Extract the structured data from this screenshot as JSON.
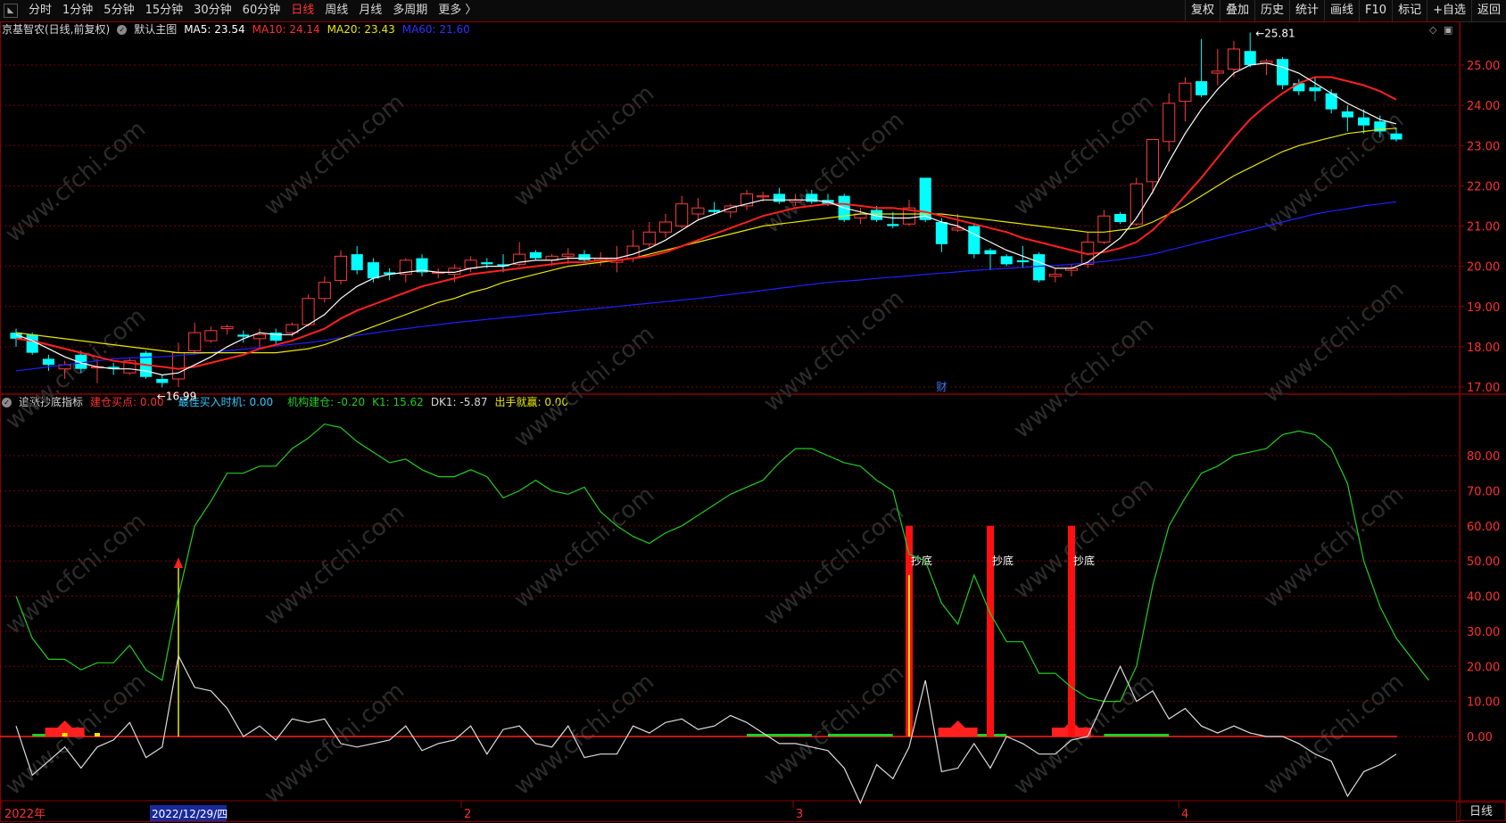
{
  "toolbar": {
    "periods": [
      "分时",
      "1分钟",
      "5分钟",
      "15分钟",
      "30分钟",
      "60分钟",
      "日线",
      "周线",
      "月线",
      "多周期",
      "更多 〉"
    ],
    "active_period": "日线",
    "tools": [
      "复权",
      "叠加",
      "历史",
      "统计",
      "画线",
      "F10",
      "标记",
      "+自选",
      "返回"
    ]
  },
  "main_header": {
    "stock": "京基智农(日线,前复权)",
    "template": "默认主图",
    "ma5": "MA5: 23.54",
    "ma10": "MA10: 24.14",
    "ma20": "MA20: 23.43",
    "ma60": "MA60: 21.60"
  },
  "sub_header": {
    "indicator": "追涨抄底指标",
    "build_buy": "建仓买点: 0.00",
    "best_buy": "最佳买入时机: 0.00",
    "inst_build": "机构建仓: -0.20",
    "k1": "K1: 15.62",
    "dk1": "DK1: -5.87",
    "win": "出手就赢: 0.00"
  },
  "watermark": "www.cfchi.com",
  "bottom": {
    "period_label": "日线",
    "date_labels": [
      "2022年",
      "2",
      "3",
      "4"
    ],
    "cursor_date": "2022/12/29/四"
  },
  "annotations": {
    "high": "25.81",
    "low": "16.99",
    "fin_marker": "财",
    "signal_label": "抄底"
  },
  "colors": {
    "up": "#ff3b3b",
    "down": "#00ffff",
    "ma5": "#ffffff",
    "ma10": "#ff2020",
    "ma20": "#e8e800",
    "ma60": "#2020ff",
    "green": "#22cc22",
    "grid": "#7a0000"
  },
  "chart_data": [
    {
      "type": "candlestick",
      "title": "京基智农(日线,前复权)",
      "ylim": [
        16.6,
        26.0
      ],
      "yticks": [
        "17.00",
        "18.00",
        "19.00",
        "20.00",
        "21.00",
        "22.00",
        "23.00",
        "24.00",
        "25.00"
      ],
      "candles": [
        [
          18.35,
          18.45,
          18.0,
          18.2
        ],
        [
          18.3,
          18.35,
          17.8,
          17.85
        ],
        [
          17.7,
          17.8,
          17.4,
          17.55
        ],
        [
          17.45,
          17.65,
          17.2,
          17.55
        ],
        [
          17.8,
          17.9,
          17.35,
          17.45
        ],
        [
          17.5,
          17.7,
          17.1,
          17.5
        ],
        [
          17.5,
          17.6,
          17.3,
          17.45
        ],
        [
          17.35,
          17.7,
          17.3,
          17.65
        ],
        [
          17.85,
          17.9,
          17.2,
          17.25
        ],
        [
          17.2,
          17.3,
          16.99,
          17.1
        ],
        [
          17.2,
          18.1,
          17.0,
          17.85
        ],
        [
          17.9,
          18.6,
          17.8,
          18.35
        ],
        [
          18.15,
          18.5,
          18.1,
          18.4
        ],
        [
          18.45,
          18.55,
          18.3,
          18.5
        ],
        [
          18.3,
          18.4,
          18.1,
          18.25
        ],
        [
          18.2,
          18.45,
          18.0,
          18.3
        ],
        [
          18.35,
          18.45,
          18.05,
          18.15
        ],
        [
          18.35,
          18.6,
          18.25,
          18.55
        ],
        [
          18.55,
          19.3,
          18.5,
          19.2
        ],
        [
          19.2,
          19.75,
          19.1,
          19.6
        ],
        [
          19.65,
          20.4,
          19.55,
          20.25
        ],
        [
          20.3,
          20.5,
          19.8,
          19.9
        ],
        [
          20.1,
          20.2,
          19.6,
          19.7
        ],
        [
          19.85,
          19.95,
          19.65,
          19.8
        ],
        [
          19.8,
          20.2,
          19.6,
          20.15
        ],
        [
          20.2,
          20.3,
          19.75,
          19.85
        ],
        [
          19.85,
          19.95,
          19.7,
          19.85
        ],
        [
          19.8,
          20.05,
          19.6,
          19.95
        ],
        [
          19.95,
          20.25,
          19.85,
          20.15
        ],
        [
          20.1,
          20.2,
          19.95,
          20.05
        ],
        [
          20.05,
          20.3,
          19.85,
          20.0
        ],
        [
          20.05,
          20.6,
          20.0,
          20.3
        ],
        [
          20.35,
          20.4,
          20.15,
          20.2
        ],
        [
          20.15,
          20.3,
          20.0,
          20.25
        ],
        [
          20.25,
          20.45,
          20.05,
          20.3
        ],
        [
          20.3,
          20.4,
          20.1,
          20.15
        ],
        [
          20.15,
          20.35,
          20.0,
          20.2
        ],
        [
          20.1,
          20.5,
          19.85,
          20.15
        ],
        [
          20.2,
          20.9,
          20.1,
          20.5
        ],
        [
          20.55,
          21.1,
          20.45,
          20.85
        ],
        [
          20.85,
          21.3,
          20.7,
          21.1
        ],
        [
          21.0,
          21.75,
          20.95,
          21.55
        ],
        [
          21.3,
          21.7,
          21.15,
          21.45
        ],
        [
          21.4,
          21.6,
          21.3,
          21.35
        ],
        [
          21.35,
          21.55,
          21.2,
          21.5
        ],
        [
          21.5,
          21.9,
          21.4,
          21.8
        ],
        [
          21.75,
          21.85,
          21.6,
          21.75
        ],
        [
          21.8,
          21.95,
          21.55,
          21.6
        ],
        [
          21.6,
          21.8,
          21.5,
          21.65
        ],
        [
          21.8,
          21.9,
          21.55,
          21.6
        ],
        [
          21.65,
          21.8,
          21.5,
          21.55
        ],
        [
          21.75,
          21.8,
          21.1,
          21.15
        ],
        [
          21.2,
          21.45,
          21.05,
          21.3
        ],
        [
          21.4,
          21.5,
          21.1,
          21.15
        ],
        [
          21.05,
          21.35,
          20.95,
          21.0
        ],
        [
          21.05,
          21.65,
          21.0,
          21.45
        ],
        [
          22.2,
          22.2,
          21.1,
          21.15
        ],
        [
          21.1,
          21.2,
          20.35,
          20.55
        ],
        [
          20.9,
          21.3,
          20.85,
          20.95
        ],
        [
          21.0,
          21.05,
          20.2,
          20.3
        ],
        [
          20.4,
          20.45,
          19.9,
          20.3
        ],
        [
          20.25,
          20.3,
          20.0,
          20.05
        ],
        [
          20.15,
          20.5,
          19.95,
          20.1
        ],
        [
          20.3,
          20.35,
          19.6,
          19.65
        ],
        [
          19.75,
          19.95,
          19.6,
          19.8
        ],
        [
          19.9,
          20.05,
          19.75,
          19.95
        ],
        [
          20.05,
          20.85,
          19.95,
          20.6
        ],
        [
          20.6,
          21.4,
          20.55,
          21.25
        ],
        [
          21.3,
          21.35,
          21.05,
          21.1
        ],
        [
          21.05,
          22.2,
          21.0,
          22.05
        ],
        [
          22.1,
          22.7,
          21.8,
          23.15
        ],
        [
          23.1,
          24.3,
          22.85,
          24.05
        ],
        [
          24.1,
          24.7,
          23.6,
          24.55
        ],
        [
          24.6,
          25.65,
          24.2,
          24.25
        ],
        [
          24.8,
          25.4,
          24.5,
          24.85
        ],
        [
          24.9,
          25.6,
          24.7,
          25.4
        ],
        [
          25.35,
          25.81,
          24.95,
          25.0
        ],
        [
          25.05,
          25.15,
          24.75,
          25.1
        ],
        [
          25.15,
          25.2,
          24.4,
          24.5
        ],
        [
          24.55,
          24.65,
          24.25,
          24.35
        ],
        [
          24.45,
          24.7,
          24.1,
          24.35
        ],
        [
          24.3,
          24.4,
          23.8,
          23.9
        ],
        [
          23.85,
          24.0,
          23.35,
          23.7
        ],
        [
          23.7,
          23.9,
          23.3,
          23.5
        ],
        [
          23.6,
          23.75,
          23.2,
          23.35
        ],
        [
          23.3,
          23.45,
          23.1,
          23.15
        ]
      ],
      "ma5": [
        18.3,
        18.15,
        17.95,
        17.75,
        17.6,
        17.5,
        17.45,
        17.45,
        17.4,
        17.3,
        17.35,
        17.55,
        17.75,
        18.0,
        18.2,
        18.35,
        18.3,
        18.3,
        18.55,
        18.8,
        19.2,
        19.5,
        19.7,
        19.8,
        19.85,
        19.9,
        19.85,
        19.85,
        19.95,
        20.0,
        20.0,
        20.1,
        20.15,
        20.15,
        20.2,
        20.2,
        20.2,
        20.2,
        20.3,
        20.45,
        20.65,
        20.9,
        21.15,
        21.3,
        21.45,
        21.55,
        21.65,
        21.65,
        21.65,
        21.65,
        21.6,
        21.45,
        21.35,
        21.25,
        21.2,
        21.2,
        21.25,
        21.1,
        21.0,
        20.8,
        20.6,
        20.4,
        20.25,
        20.1,
        19.95,
        19.95,
        20.1,
        20.4,
        20.7,
        21.2,
        21.85,
        22.6,
        23.3,
        23.9,
        24.4,
        24.8,
        25.0,
        25.05,
        24.95,
        24.8,
        24.55,
        24.3,
        24.05,
        23.85,
        23.65,
        23.54
      ],
      "ma10": [
        18.2,
        18.15,
        18.05,
        17.95,
        17.85,
        17.75,
        17.65,
        17.6,
        17.55,
        17.5,
        17.45,
        17.5,
        17.6,
        17.7,
        17.8,
        17.95,
        18.05,
        18.15,
        18.3,
        18.45,
        18.7,
        18.9,
        19.05,
        19.2,
        19.35,
        19.5,
        19.6,
        19.7,
        19.8,
        19.85,
        19.9,
        19.95,
        20.0,
        20.05,
        20.1,
        20.1,
        20.15,
        20.15,
        20.2,
        20.25,
        20.35,
        20.5,
        20.65,
        20.8,
        20.95,
        21.1,
        21.25,
        21.35,
        21.45,
        21.5,
        21.55,
        21.55,
        21.5,
        21.45,
        21.45,
        21.4,
        21.35,
        21.25,
        21.15,
        21.05,
        20.95,
        20.85,
        20.7,
        20.6,
        20.5,
        20.4,
        20.3,
        20.35,
        20.45,
        20.6,
        20.9,
        21.3,
        21.75,
        22.2,
        22.7,
        23.2,
        23.65,
        24.0,
        24.3,
        24.55,
        24.7,
        24.7,
        24.6,
        24.5,
        24.35,
        24.14
      ],
      "ma20": [
        18.35,
        18.3,
        18.25,
        18.2,
        18.15,
        18.1,
        18.05,
        18.0,
        17.95,
        17.9,
        17.85,
        17.85,
        17.85,
        17.85,
        17.85,
        17.85,
        17.85,
        17.9,
        17.95,
        18.05,
        18.2,
        18.35,
        18.5,
        18.65,
        18.8,
        18.95,
        19.1,
        19.2,
        19.35,
        19.45,
        19.6,
        19.7,
        19.8,
        19.9,
        20.0,
        20.05,
        20.1,
        20.15,
        20.2,
        20.3,
        20.4,
        20.5,
        20.6,
        20.7,
        20.8,
        20.9,
        21.0,
        21.05,
        21.1,
        21.15,
        21.2,
        21.25,
        21.3,
        21.3,
        21.3,
        21.3,
        21.3,
        21.3,
        21.25,
        21.2,
        21.15,
        21.1,
        21.05,
        21.0,
        20.95,
        20.9,
        20.85,
        20.85,
        20.9,
        20.95,
        21.1,
        21.3,
        21.5,
        21.75,
        22.0,
        22.25,
        22.45,
        22.65,
        22.85,
        23.0,
        23.1,
        23.2,
        23.3,
        23.35,
        23.4,
        23.43
      ],
      "ma60": [
        17.4,
        17.45,
        17.5,
        17.55,
        17.6,
        17.65,
        17.7,
        17.72,
        17.74,
        17.75,
        17.78,
        17.82,
        17.86,
        17.9,
        17.94,
        17.98,
        18.02,
        18.06,
        18.1,
        18.16,
        18.22,
        18.28,
        18.34,
        18.4,
        18.45,
        18.5,
        18.55,
        18.6,
        18.64,
        18.68,
        18.72,
        18.76,
        18.8,
        18.84,
        18.88,
        18.92,
        18.96,
        19.0,
        19.04,
        19.08,
        19.12,
        19.16,
        19.2,
        19.25,
        19.3,
        19.35,
        19.4,
        19.45,
        19.5,
        19.55,
        19.6,
        19.63,
        19.66,
        19.7,
        19.73,
        19.76,
        19.8,
        19.83,
        19.86,
        19.9,
        19.92,
        19.95,
        19.97,
        20.0,
        20.02,
        20.05,
        20.08,
        20.12,
        20.17,
        20.23,
        20.3,
        20.4,
        20.5,
        20.6,
        20.7,
        20.8,
        20.9,
        21.0,
        21.1,
        21.2,
        21.3,
        21.37,
        21.43,
        21.5,
        21.55,
        21.6
      ]
    },
    {
      "type": "line",
      "title": "追涨抄底指标",
      "ylim": [
        -20,
        92
      ],
      "yticks": [
        "0.00",
        "10.00",
        "20.00",
        "30.00",
        "40.00",
        "50.00",
        "60.00",
        "70.00",
        "80.00"
      ],
      "series": [
        {
          "name": "K1",
          "values": [
            40,
            28,
            22,
            22,
            19,
            21,
            21,
            26,
            19,
            16,
            40,
            60,
            67,
            75,
            75,
            77,
            77,
            82,
            85,
            89,
            88,
            84,
            81,
            78,
            79,
            76,
            74,
            74,
            76,
            74,
            68,
            70,
            73,
            70,
            69,
            71,
            64,
            60,
            57,
            55,
            58,
            60,
            63,
            66,
            69,
            71,
            73,
            78,
            82,
            82,
            80,
            78,
            77,
            73,
            70,
            52,
            50,
            38,
            32,
            46,
            35,
            27,
            27,
            18,
            18,
            14,
            11,
            10,
            10,
            20,
            43,
            60,
            68,
            75,
            77,
            80,
            81,
            82,
            86,
            87,
            86,
            82,
            72,
            50,
            37,
            28,
            22,
            16
          ]
        },
        {
          "name": "white",
          "values": [
            3,
            -11,
            -7,
            -3,
            -9,
            -3,
            -1,
            4,
            -6,
            -3,
            23,
            14,
            13,
            8,
            0,
            3,
            -1,
            5,
            4,
            5,
            -2,
            -3,
            -2,
            -1,
            3,
            -4,
            -2,
            -1,
            3,
            -5,
            2,
            3,
            -2,
            -3,
            3,
            -6,
            -5,
            -5,
            3,
            1,
            4,
            5,
            2,
            3,
            6,
            4,
            1,
            -2,
            -2,
            -3,
            -4,
            -9,
            -19,
            -8,
            -12,
            -3,
            16,
            -10,
            -9,
            -2,
            -9,
            0,
            -2,
            -5,
            -5,
            -1,
            0,
            10,
            20,
            10,
            13,
            5,
            8,
            3,
            1,
            3,
            1,
            0,
            0,
            -2,
            -5,
            -7,
            -17,
            -10,
            -8,
            -5
          ]
        }
      ],
      "signals": {
        "bars_at": [
          55,
          60,
          65
        ],
        "bar_value": 60
      }
    }
  ]
}
